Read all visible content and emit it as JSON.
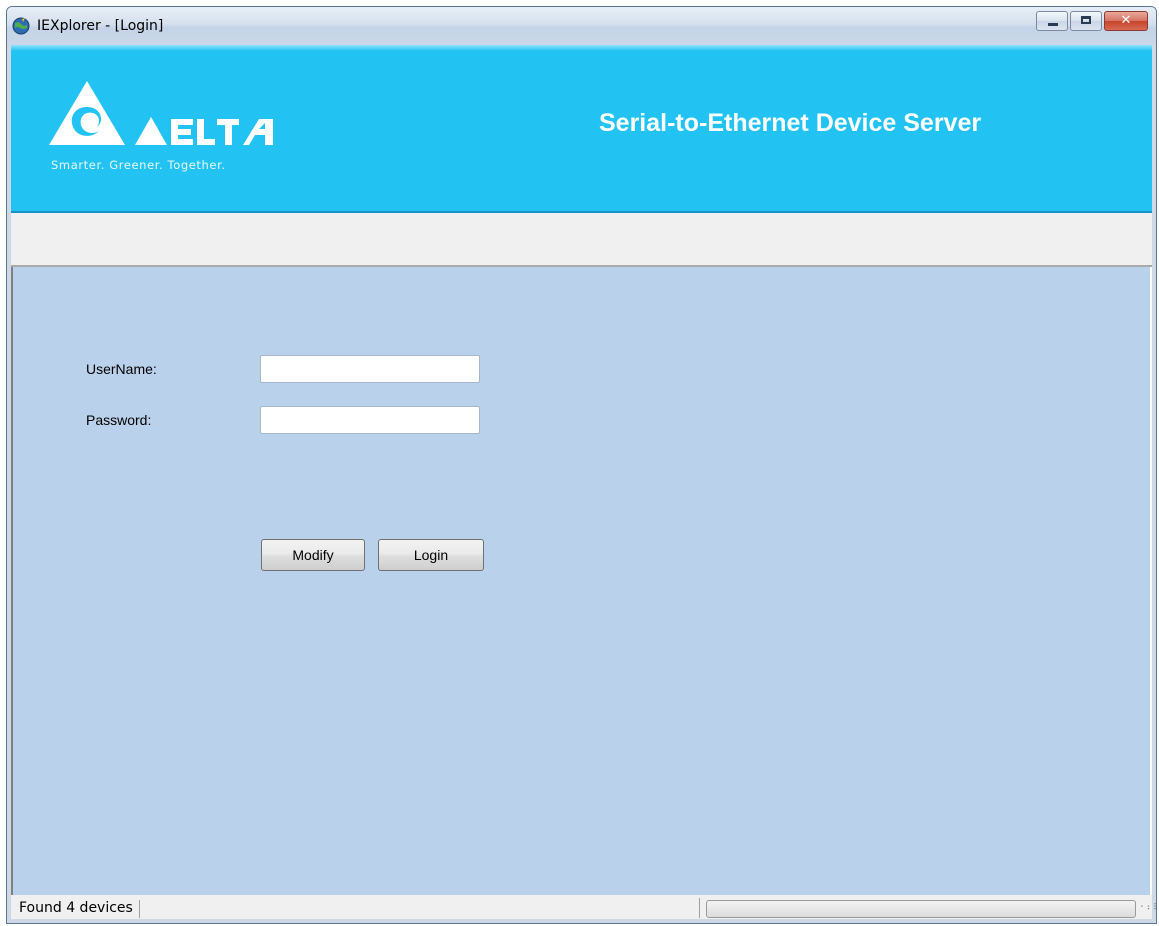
{
  "window": {
    "title": "IEXplorer - [Login]",
    "minimize_icon": "minimize-icon",
    "maximize_icon": "maximize-icon",
    "close_icon": "close-icon",
    "close_glyph": "✕"
  },
  "banner": {
    "logo_text": "DELTA",
    "tagline": "Smarter. Greener. Together.",
    "title": "Serial-to-Ethernet Device Server",
    "color": "#22c3f2"
  },
  "login": {
    "username_label": "UserName:",
    "username_value": "",
    "password_label": "Password:",
    "password_value": "",
    "modify_label": "Modify",
    "login_label": "Login"
  },
  "status": {
    "text": "Found 4 devices",
    "progress": 0
  },
  "colors": {
    "content_bg": "#b9d1ea",
    "banner_bg": "#22c3f2"
  }
}
